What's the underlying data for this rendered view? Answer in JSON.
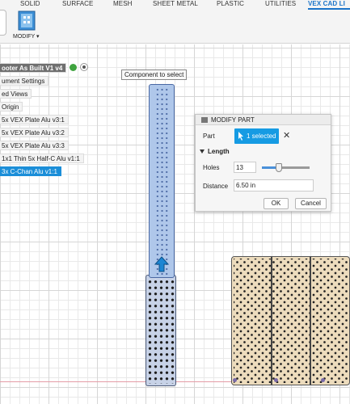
{
  "ribbon": {
    "tabs": [
      {
        "label": "SOLID",
        "active": false
      },
      {
        "label": "SURFACE",
        "active": false
      },
      {
        "label": "MESH",
        "active": false
      },
      {
        "label": "SHEET METAL",
        "active": false
      },
      {
        "label": "PLASTIC",
        "active": false
      },
      {
        "label": "UTILITIES",
        "active": false
      },
      {
        "label": "VEX CAD LI",
        "active": true
      }
    ],
    "modify_label": "MODIFY ▾",
    "modify_icon": "modify-part-icon"
  },
  "browser": {
    "items": [
      {
        "label": "ooter As Built V1 v4",
        "kind": "root"
      },
      {
        "label": "ument Settings",
        "kind": "item"
      },
      {
        "label": "ed Views",
        "kind": "item"
      },
      {
        "label": "Origin",
        "kind": "item"
      },
      {
        "label": "5x VEX Plate Alu v3:1",
        "kind": "item"
      },
      {
        "label": "5x VEX Plate Alu v3:2",
        "kind": "item"
      },
      {
        "label": "5x VEX Plate Alu v3:3",
        "kind": "item"
      },
      {
        "label": "1x1 Thin 5x Half-C Alu v1:1",
        "kind": "item"
      },
      {
        "label": "3x C-Chan Alu v1:1",
        "kind": "selected"
      }
    ],
    "root_icons": [
      "visibility-icon",
      "activate-radio-icon"
    ]
  },
  "tooltip": "Component to select",
  "dialog": {
    "title": "MODIFY PART",
    "part_label": "Part",
    "part_selection": "1 selected",
    "clear_icon": "close-icon",
    "length_group": "Length",
    "holes_label": "Holes",
    "holes_value": "13",
    "holes_slider_fraction": 0.36,
    "distance_label": "Distance",
    "distance_value": "6.50 in",
    "ok_label": "OK",
    "cancel_label": "Cancel"
  },
  "colors": {
    "accent": "#1a74c9",
    "selection": "#169be3",
    "part_selected": "#afc7ea",
    "plate": "#eddcbd"
  }
}
